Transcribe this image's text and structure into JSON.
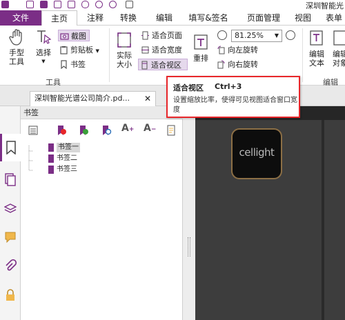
{
  "titlebar": {
    "app_title": "深圳智能光"
  },
  "tabs": [
    {
      "label": "文件"
    },
    {
      "label": "主页"
    },
    {
      "label": "注释"
    },
    {
      "label": "转换"
    },
    {
      "label": "编辑"
    },
    {
      "label": "填写&签名"
    },
    {
      "label": "页面管理"
    },
    {
      "label": "视图"
    },
    {
      "label": "表单"
    }
  ],
  "ribbon": {
    "hand_tool": "手型\n工具",
    "select": "选择",
    "screenshot": "截图",
    "clipboard": "剪贴板",
    "bookmark": "书签",
    "tools_group": "工具",
    "actual_size": "实际\n大小",
    "fit_page": "适合页面",
    "fit_width": "适合宽度",
    "fit_view": "适合视区",
    "reflow": "重排",
    "zoom_value": "81.25%",
    "rotate_left": "向左旋转",
    "rotate_right": "向右旋转",
    "edit_text": "编辑\n文本",
    "edit_object": "编辑\n对象",
    "edit_group": "编辑"
  },
  "document": {
    "tab_title": "深圳智能光谱公司简介.pd..."
  },
  "bookmark_panel": {
    "title": "书签",
    "items": [
      {
        "label": "书签一"
      },
      {
        "label": "书签二"
      },
      {
        "label": "书签三"
      }
    ]
  },
  "page_logo": {
    "text": "cellight"
  },
  "tooltip": {
    "title": "适合视区",
    "shortcut": "Ctrl+3",
    "description": "设置缩放比率，使得可见视图适合窗口宽度"
  },
  "colors": {
    "accent": "#7b2e86",
    "tooltip_border": "#e8262a",
    "canvas": "#262626"
  }
}
